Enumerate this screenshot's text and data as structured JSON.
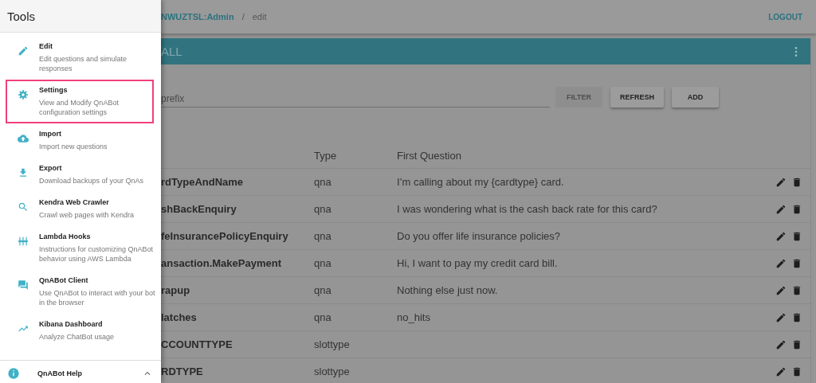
{
  "drawer": {
    "title": "Tools",
    "items": [
      {
        "title": "Edit",
        "description": "Edit questions and simulate responses",
        "highlighted": false
      },
      {
        "title": "Settings",
        "description": "View and Modify QnABot configuration settings",
        "highlighted": true
      },
      {
        "title": "Import",
        "description": "Import new questions",
        "highlighted": false
      },
      {
        "title": "Export",
        "description": "Download backups of your QnAs",
        "highlighted": false
      },
      {
        "title": "Kendra Web Crawler",
        "description": "Crawl web pages with Kendra",
        "highlighted": false
      },
      {
        "title": "Lambda Hooks",
        "description": "Instructions for customizing QnABot behavior using AWS Lambda",
        "highlighted": false
      },
      {
        "title": "QnABot Client",
        "description": "Use QnABot to interact with your bot in the browser",
        "highlighted": false
      },
      {
        "title": "Kibana Dashboard",
        "description": "Analyze ChatBot usage",
        "highlighted": false
      }
    ],
    "footer_item": {
      "title": "QnABot Help",
      "expanded": true
    }
  },
  "topbar": {
    "breadcrumb": {
      "parent": "NWUZTSL:Admin",
      "separator": "/",
      "current": "edit"
    },
    "logout": "LOGOUT"
  },
  "card": {
    "title": "ALL",
    "filter": {
      "placeholder": "prefix"
    },
    "buttons": [
      {
        "label": "FILTER",
        "disabled": true
      },
      {
        "label": "REFRESH",
        "disabled": false
      },
      {
        "label": "ADD",
        "disabled": false
      }
    ],
    "columns": [
      "Type",
      "First Question"
    ],
    "rows": [
      {
        "name": "rdTypeAndName",
        "type": "qna",
        "question": "I’m calling about my {cardtype} card."
      },
      {
        "name": "shBackEnquiry",
        "type": "qna",
        "question": "I was wondering what is the cash back rate for this card?"
      },
      {
        "name": "feInsurancePolicyEnquiry",
        "type": "qna",
        "question": "Do you offer life insurance policies?"
      },
      {
        "name": "ansaction.MakePayment",
        "type": "qna",
        "question": "Hi, I want to pay my credit card bill."
      },
      {
        "name": "rapup",
        "type": "qna",
        "question": "Nothing else just now."
      },
      {
        "name": "latches",
        "type": "qna",
        "question": "no_hits"
      },
      {
        "name": "CCOUNTTYPE",
        "type": "slottype",
        "question": ""
      },
      {
        "name": "RDTYPE",
        "type": "slottype",
        "question": ""
      }
    ]
  }
}
